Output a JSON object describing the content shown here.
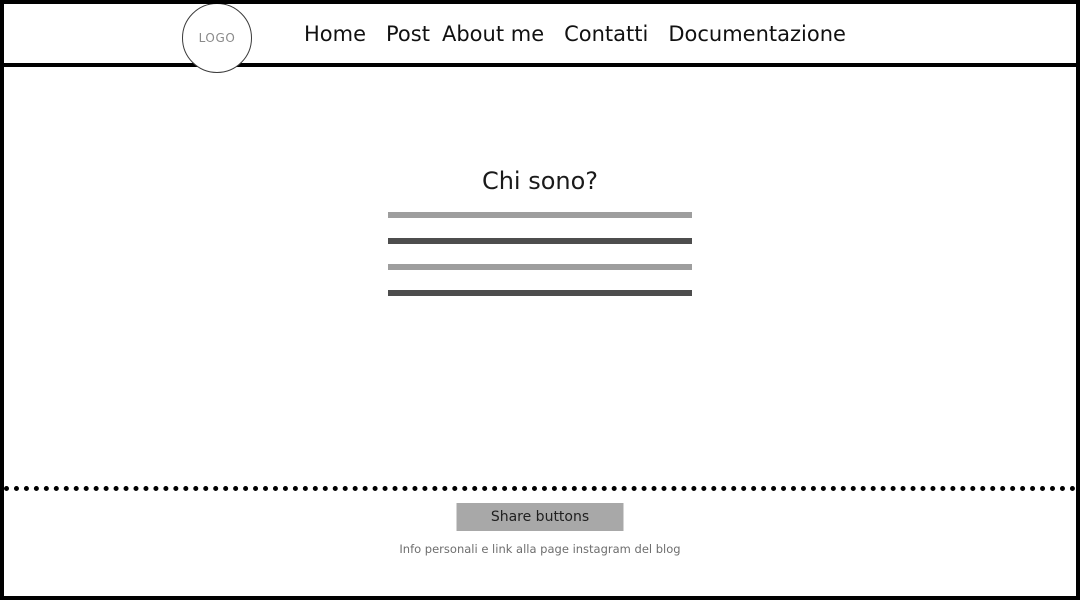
{
  "page": {
    "background": "#ffffff",
    "border_color": "#000000"
  },
  "header": {
    "logo": {
      "label": "LOGO",
      "shape": "circle",
      "text_color": "#8a8a8a"
    },
    "nav": [
      {
        "label": "Home"
      },
      {
        "label": "Post"
      },
      {
        "label": "About me"
      },
      {
        "label": "Contatti"
      },
      {
        "label": "Documentazione"
      }
    ]
  },
  "main": {
    "title": "Chi sono?",
    "content_placeholder_bars": [
      {
        "tone": "light",
        "color": "#9e9e9e"
      },
      {
        "tone": "dark",
        "color": "#4d4d4d"
      },
      {
        "tone": "light",
        "color": "#9e9e9e"
      },
      {
        "tone": "dark",
        "color": "#4d4d4d"
      }
    ]
  },
  "footer": {
    "divider_style": "dotted",
    "share_button_label": "Share buttons",
    "share_button_color": "#a8a8a8",
    "note": "Info personali e link alla page instagram del blog"
  }
}
